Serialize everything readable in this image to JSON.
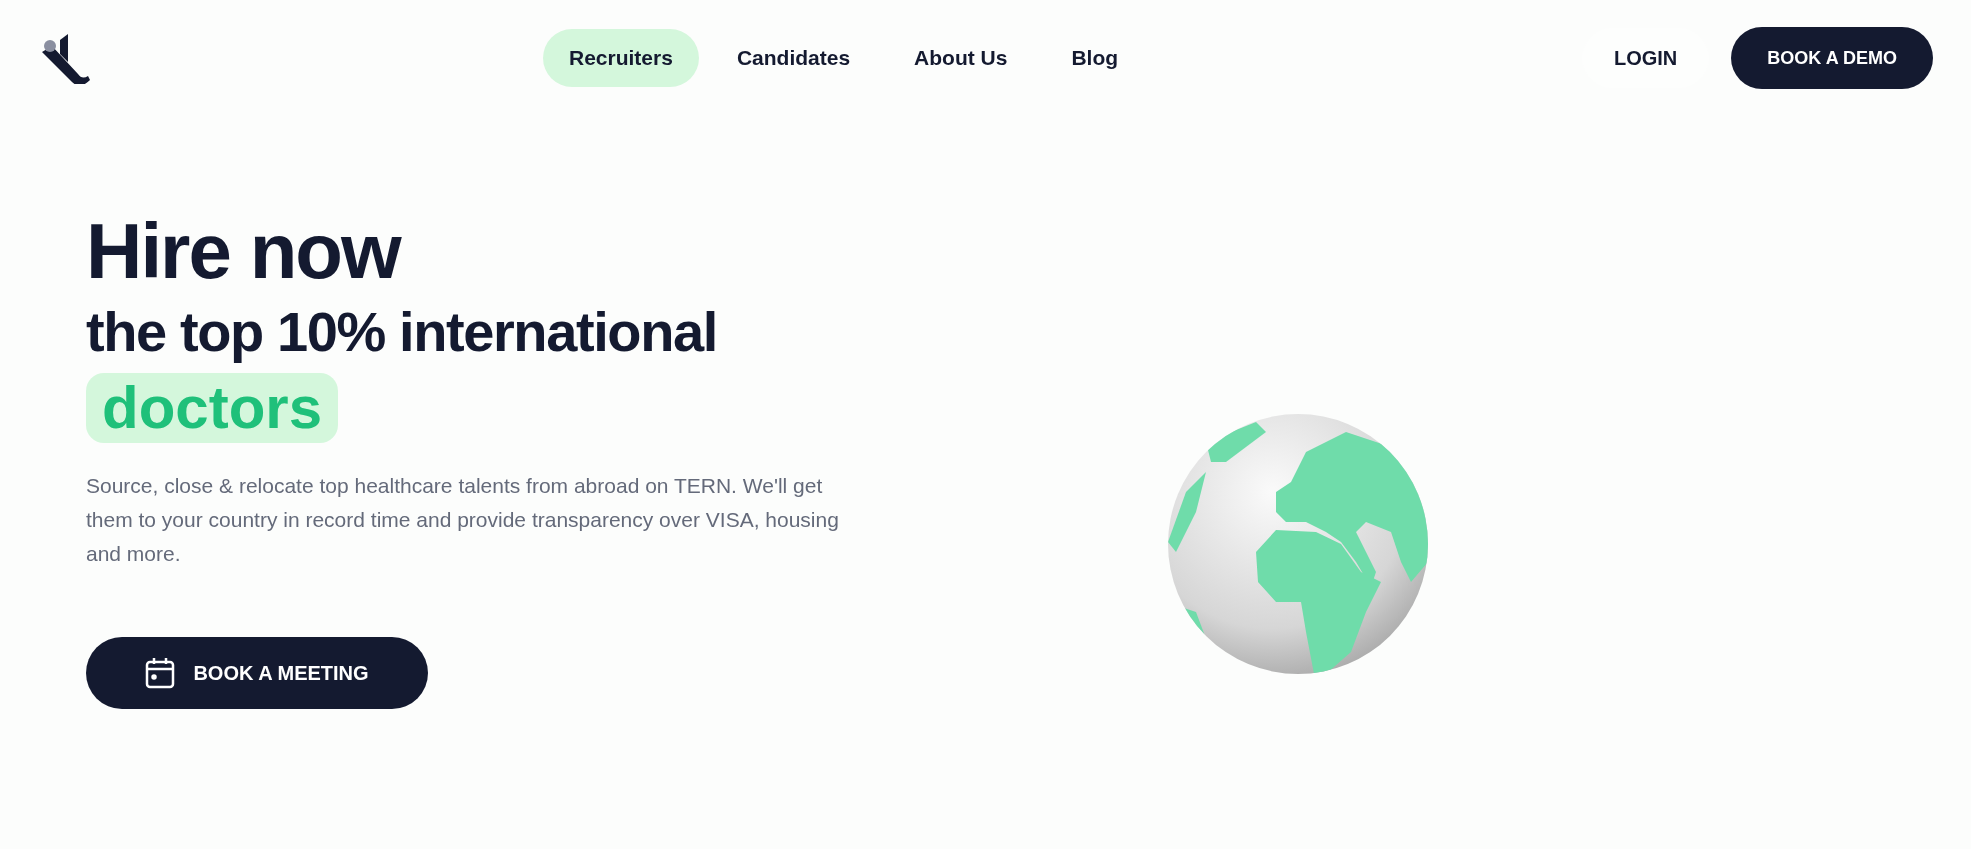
{
  "nav": {
    "items": [
      {
        "label": "Recruiters",
        "selected": true
      },
      {
        "label": "Candidates",
        "selected": false
      },
      {
        "label": "About Us",
        "selected": false
      },
      {
        "label": "Blog",
        "selected": false
      }
    ],
    "login": "LOGIN",
    "cta": "BOOK A DEMO"
  },
  "hero": {
    "title": "Hire now",
    "subtitle": "the top 10% international",
    "highlight": "doctors",
    "description": "Source, close & relocate top healthcare talents from abroad on TERN. We'll get them to your country in record time and provide transparency over VISA, housing and more.",
    "button": "BOOK A MEETING"
  }
}
